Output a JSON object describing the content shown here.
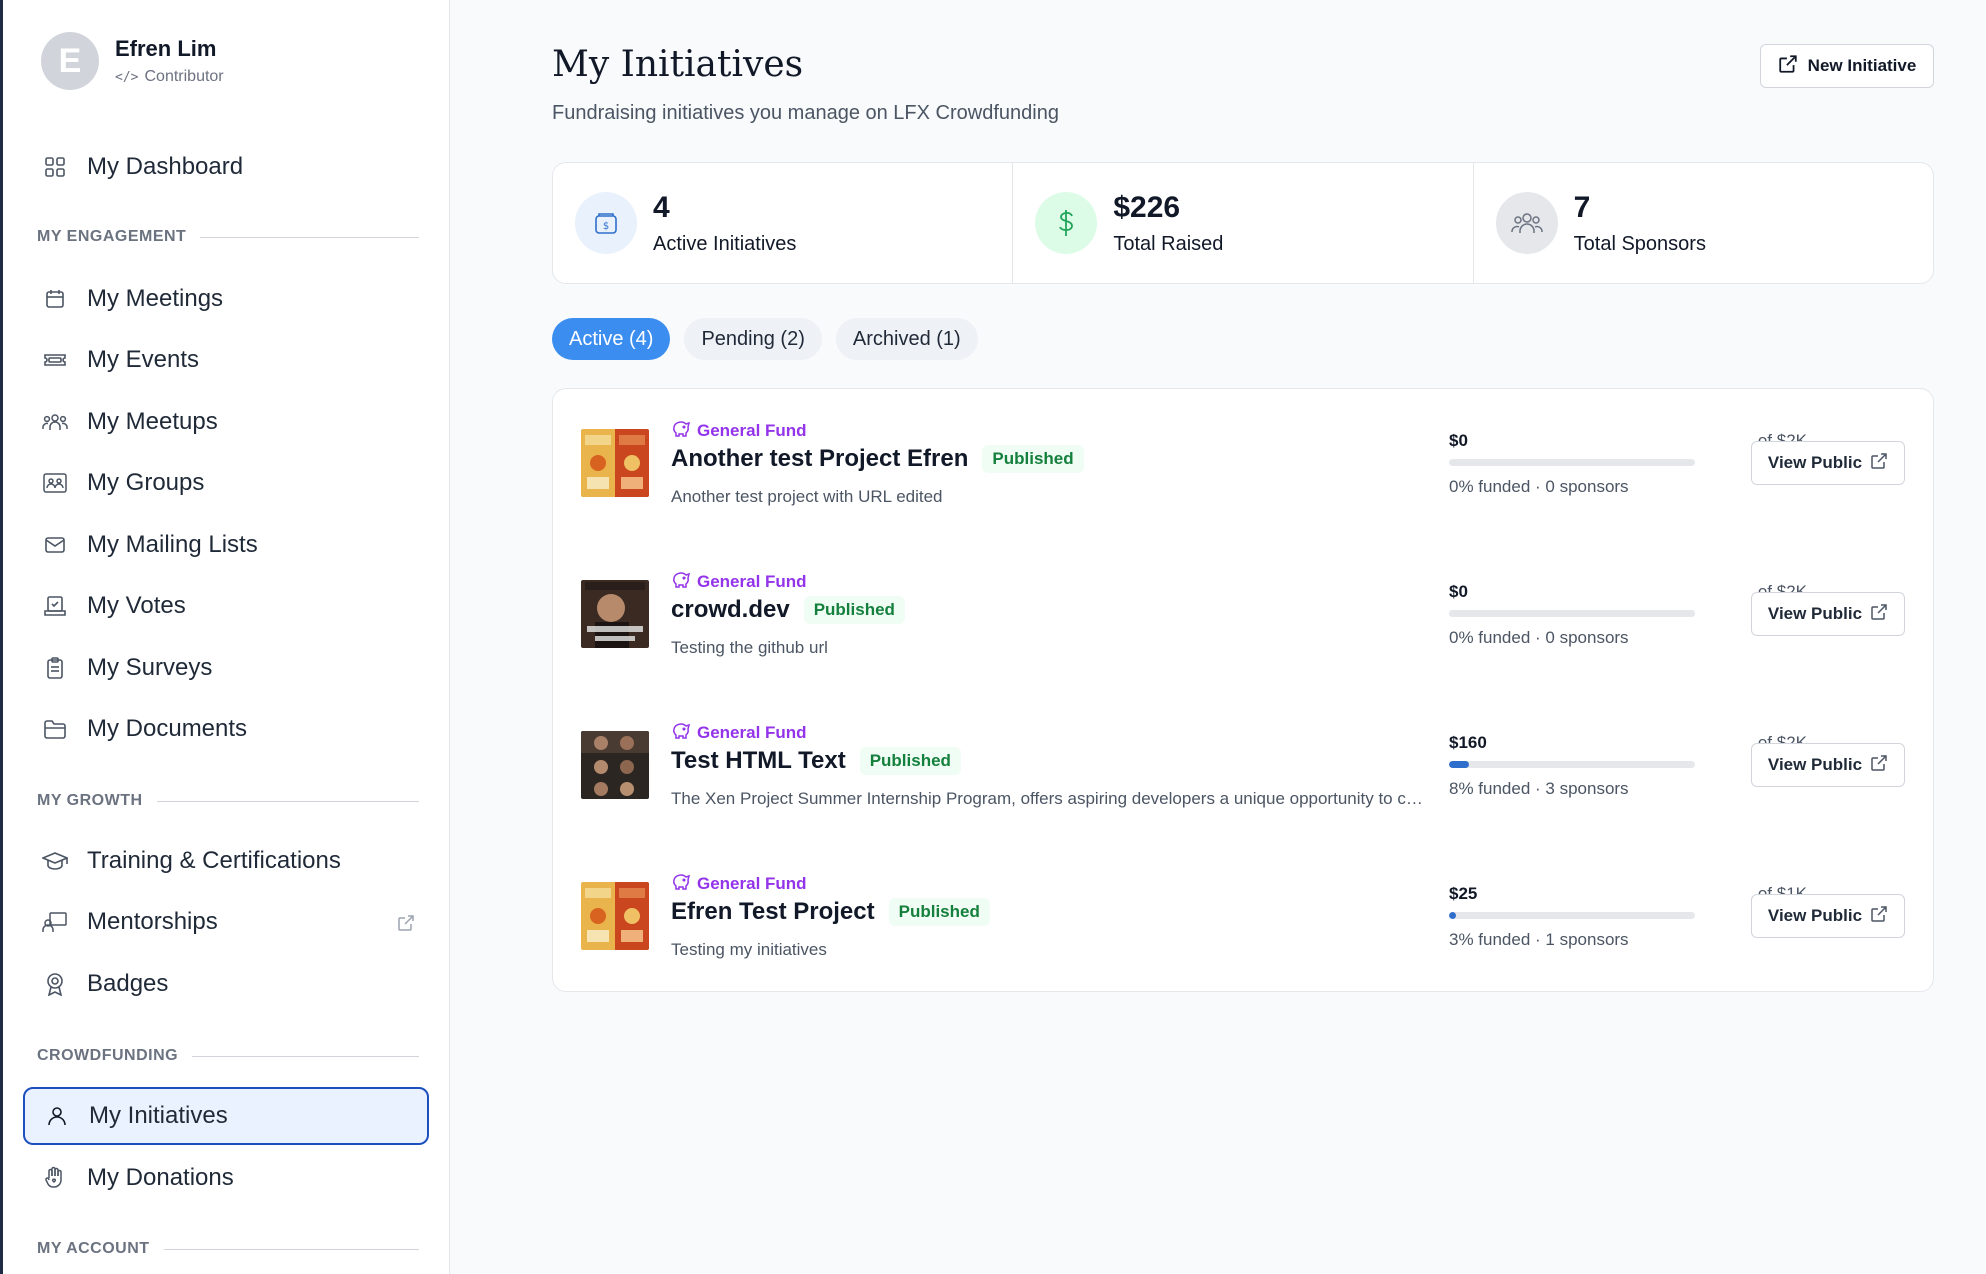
{
  "user": {
    "initial": "E",
    "name": "Efren Lim",
    "role_code": "</>",
    "role": "Contributor"
  },
  "nav": {
    "dashboard": "My Dashboard",
    "engagement_header": "MY ENGAGEMENT",
    "meetings": "My Meetings",
    "events": "My Events",
    "meetups": "My Meetups",
    "groups": "My Groups",
    "mailing_lists": "My Mailing Lists",
    "votes": "My Votes",
    "surveys": "My Surveys",
    "documents": "My Documents",
    "growth_header": "MY GROWTH",
    "training": "Training & Certifications",
    "mentorships": "Mentorships",
    "badges": "Badges",
    "crowdfunding_header": "CROWDFUNDING",
    "initiatives": "My Initiatives",
    "donations": "My Donations",
    "account_header": "MY ACCOUNT"
  },
  "header": {
    "title": "My Initiatives",
    "subtitle": "Fundraising initiatives you manage on LFX Crowdfunding",
    "new_button": "New Initiative"
  },
  "stats": [
    {
      "value": "4",
      "label": "Active Initiatives"
    },
    {
      "value": "$226",
      "label": "Total Raised"
    },
    {
      "value": "7",
      "label": "Total Sponsors"
    }
  ],
  "tabs": [
    {
      "label": "Active (4)"
    },
    {
      "label": "Pending (2)"
    },
    {
      "label": "Archived (1)"
    }
  ],
  "initiatives": [
    {
      "fund": "General Fund",
      "title": "Another test Project Efren",
      "status": "Published",
      "description": "Another test project with URL edited",
      "amount": "$0",
      "goal": "of $2K",
      "progress_fraction": 0.0,
      "funded_text": "0% funded · 0 sponsors",
      "button": "View Public"
    },
    {
      "fund": "General Fund",
      "title": "crowd.dev",
      "status": "Published",
      "description": "Testing the github url",
      "amount": "$0",
      "goal": "of $2K",
      "progress_fraction": 0.0,
      "funded_text": "0% funded · 0 sponsors",
      "button": "View Public"
    },
    {
      "fund": "General Fund",
      "title": "Test HTML Text",
      "status": "Published",
      "description": "The Xen Project Summer Internship Program, offers aspiring developers a unique opportunity to contribute to open source",
      "amount": "$160",
      "goal": "of $2K",
      "progress_fraction": 0.08,
      "funded_text": "8% funded · 3 sponsors",
      "button": "View Public"
    },
    {
      "fund": "General Fund",
      "title": "Efren Test Project",
      "status": "Published",
      "description": "Testing my initiatives",
      "amount": "$25",
      "goal": "of $1K",
      "progress_fraction": 0.03,
      "funded_text": "3% funded · 1 sponsors",
      "button": "View Public"
    }
  ],
  "colors": {
    "accent": "#3b8df0",
    "active_nav_border": "#1e4fbf",
    "fund_purple": "#9333ea",
    "published_green": "#15803d",
    "progress_blue": "#2f6fcb"
  }
}
